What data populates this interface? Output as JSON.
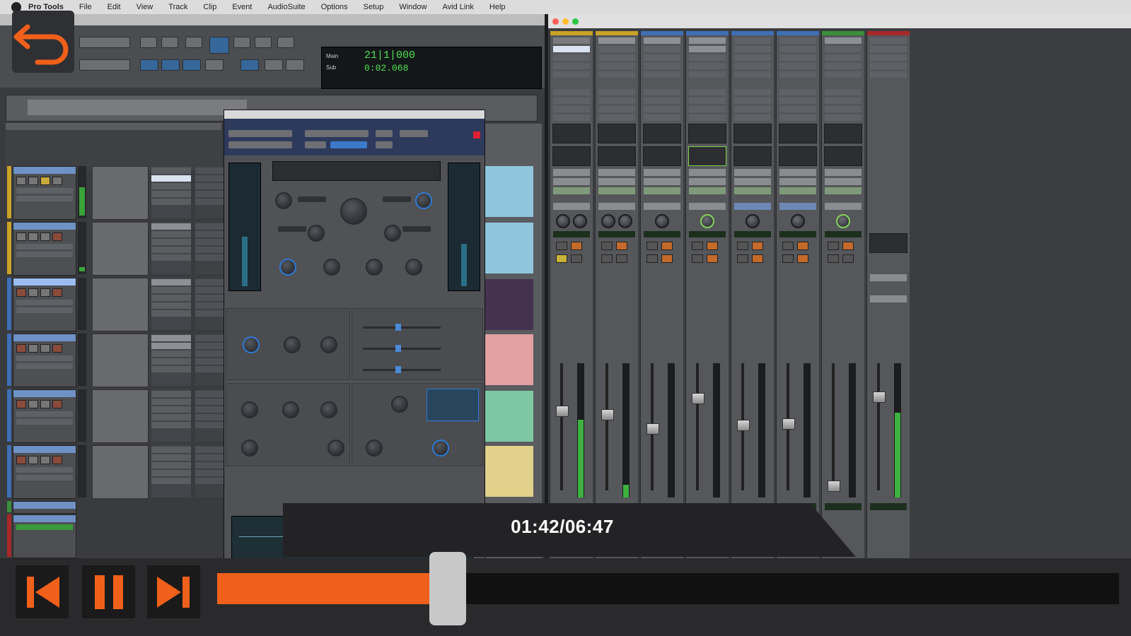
{
  "menubar": {
    "app_name": "Pro Tools",
    "items": [
      "File",
      "Edit",
      "View",
      "Track",
      "Clip",
      "Event",
      "AudioSuite",
      "Options",
      "Setup",
      "Window",
      "Avid Link",
      "Help"
    ]
  },
  "player": {
    "time_display": "01:42/06:47",
    "progress": 0.237,
    "accent_color": "#f0601a"
  },
  "counter": {
    "main_label": "Main",
    "sub_label": "Sub",
    "main_value": "21|1|000",
    "sub_value": "0:02.068"
  },
  "icons": {
    "back": "undo-arrow-icon",
    "previous": "skip-previous-icon",
    "pause": "pause-icon",
    "next": "skip-next-icon"
  }
}
